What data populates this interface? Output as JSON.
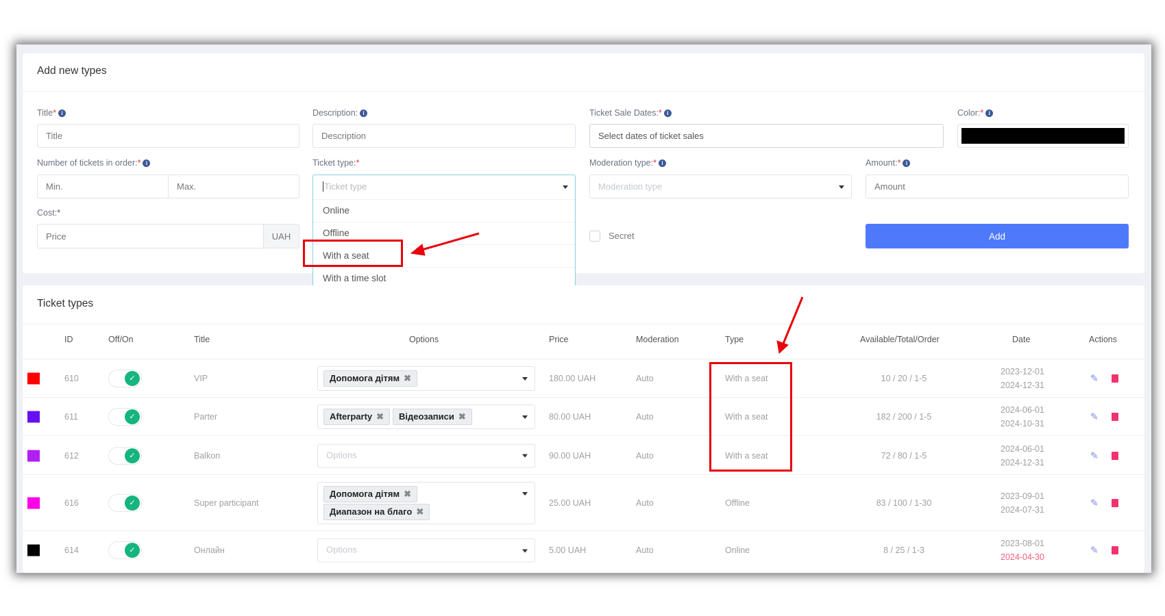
{
  "form": {
    "header": "Add new types",
    "title_label": "Title",
    "title_placeholder": "Title",
    "description_label": "Description:",
    "description_placeholder": "Description",
    "dates_label": "Ticket Sale Dates:",
    "dates_placeholder": "Select dates of ticket sales",
    "color_label": "Color:",
    "color_value": "#000000",
    "tickets_label": "Number of tickets in order:",
    "min_placeholder": "Min.",
    "max_placeholder": "Max.",
    "ticket_type_label": "Ticket type:",
    "ticket_type_placeholder": "Ticket type",
    "ticket_type_options": [
      "Online",
      "Offline",
      "With a seat",
      "With a time slot"
    ],
    "moderation_label": "Moderation type:",
    "moderation_placeholder": "Moderation type",
    "amount_label": "Amount:",
    "amount_placeholder": "Amount",
    "cost_label": "Cost:",
    "price_placeholder": "Price",
    "currency": "UAH",
    "secret_label": "Secret",
    "secret_checked": false,
    "add_button": "Add",
    "accent_color": "#4e79fb",
    "required_mark": "*"
  },
  "table": {
    "header": "Ticket types",
    "columns": [
      "ID",
      "Off/On",
      "Title",
      "Options",
      "Price",
      "Moderation",
      "Type",
      "Available/Total/Order",
      "Date",
      "Actions"
    ],
    "options_placeholder": "Options",
    "rows": [
      {
        "color": "#ff0000",
        "id": "610",
        "on": true,
        "title": "VIP",
        "options": [
          "Допомога дітям"
        ],
        "price": "180.00 UAH",
        "moderation": "Auto",
        "type": "With a seat",
        "counts": "10 / 20 / 1-5",
        "date_start": "2023-12-01",
        "date_end": "2024-12-31",
        "expired": false
      },
      {
        "color": "#6610f2",
        "id": "611",
        "on": true,
        "title": "Parter",
        "options": [
          "Afterparty",
          "Відеозаписи"
        ],
        "price": "80.00 UAH",
        "moderation": "Auto",
        "type": "With a seat",
        "counts": "182 / 200 / 1-5",
        "date_start": "2024-06-01",
        "date_end": "2024-10-31",
        "expired": false
      },
      {
        "color": "#b21ff2",
        "id": "612",
        "on": true,
        "title": "Balkon",
        "options": [],
        "price": "90.00 UAH",
        "moderation": "Auto",
        "type": "With a seat",
        "counts": "72 / 80 / 1-5",
        "date_start": "2024-06-01",
        "date_end": "2024-12-31",
        "expired": false
      },
      {
        "color": "#ff00e6",
        "id": "616",
        "on": true,
        "title": "Super participant",
        "options": [
          "Допомога дітям",
          "Диапазон на благо"
        ],
        "price": "25.00 UAH",
        "moderation": "Auto",
        "type": "Offline",
        "counts": "83 / 100 / 1-30",
        "date_start": "2023-09-01",
        "date_end": "2024-07-31",
        "expired": false
      },
      {
        "color": "#000000",
        "id": "614",
        "on": true,
        "title": "Онлайн",
        "options": [],
        "price": "5.00 UAH",
        "moderation": "Auto",
        "type": "Online",
        "counts": "8 / 25 / 1-3",
        "date_start": "2023-08-01",
        "date_end": "2024-04-30",
        "expired": true
      }
    ]
  },
  "annotation_color": "#e8000b"
}
